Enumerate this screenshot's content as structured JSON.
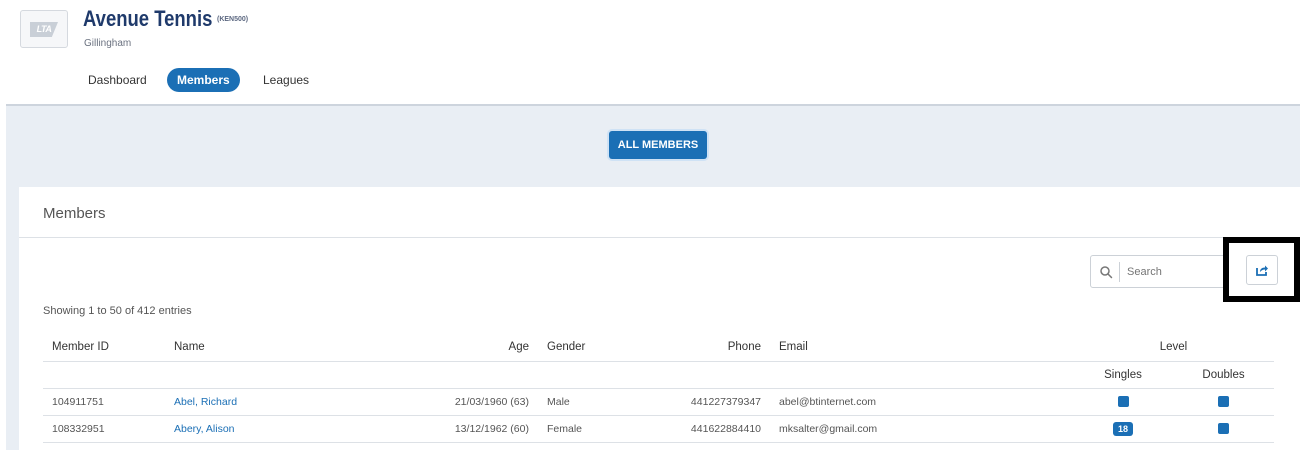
{
  "club": {
    "name": "Avenue Tennis",
    "code": "(KEN500)",
    "location": "Gillingham",
    "logo_text": "LTA"
  },
  "nav": {
    "tabs": [
      {
        "label": "Dashboard",
        "active": false
      },
      {
        "label": "Members",
        "active": true
      },
      {
        "label": "Leagues",
        "active": false
      }
    ]
  },
  "filter": {
    "all_members_label": "ALL MEMBERS"
  },
  "panel": {
    "title": "Members",
    "search_placeholder": "Search",
    "showing_text": "Showing 1 to 50 of 412 entries"
  },
  "table": {
    "headers": {
      "member_id": "Member ID",
      "name": "Name",
      "age": "Age",
      "gender": "Gender",
      "phone": "Phone",
      "email": "Email",
      "level": "Level",
      "singles": "Singles",
      "doubles": "Doubles"
    },
    "rows": [
      {
        "member_id": "104911751",
        "name": "Abel, Richard",
        "age": "21/03/1960 (63)",
        "gender": "Male",
        "phone": "441227379347",
        "email": "abel@btinternet.com",
        "singles": "",
        "doubles": ""
      },
      {
        "member_id": "108332951",
        "name": "Abery, Alison",
        "age": "13/12/1962 (60)",
        "gender": "Female",
        "phone": "441622884410",
        "email": "mksalter@gmail.com",
        "singles": "18",
        "doubles": ""
      }
    ]
  },
  "colors": {
    "primary": "#1b6fb5",
    "title": "#1f3a6b",
    "background": "#e9eef4"
  }
}
